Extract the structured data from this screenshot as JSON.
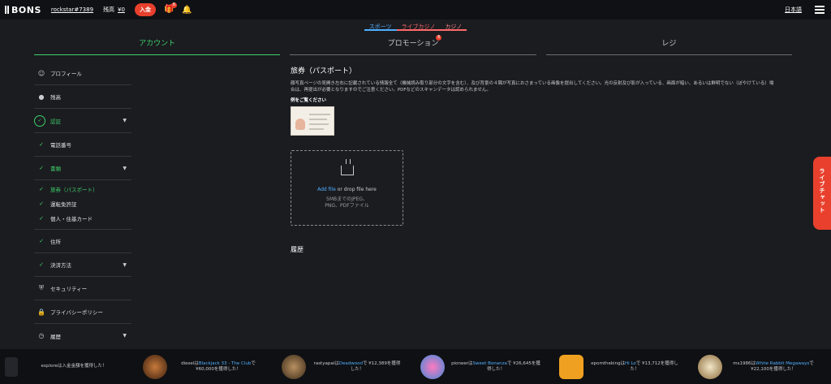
{
  "header": {
    "logo": "BONS",
    "username": "rockstar#7389",
    "balance_label": "残高",
    "balance_value": "¥0",
    "deposit_label": "入金",
    "gift_badge": "6",
    "language": "日本語"
  },
  "subnav": [
    "スポーツ",
    "ライブカジノ",
    "カジノ"
  ],
  "tabs": [
    {
      "label": "アカウント",
      "active": true
    },
    {
      "label": "プロモーション",
      "badge": "6"
    },
    {
      "label": "レジ"
    }
  ],
  "sidebar": {
    "profile": "プロフィール",
    "balance": "残高",
    "verification": "認証",
    "phone": "電話番号",
    "documents": "書類",
    "passport": "旅券（パスポート）",
    "license": "運転免許証",
    "id_card": "個人・住基カード",
    "address": "住所",
    "payment_methods": "決済方法",
    "security": "セキュリティー",
    "privacy": "プライバシーポリシー",
    "history": "履歴"
  },
  "main": {
    "title": "旅券（パスポート）",
    "description": "顔写真ページの見開き左右に記載されている情報全て（機械読み取り部分の文字を含む）、及び背景の４隅が写真におさまっている画像を提出してください。光の反射及び影が入っている、画面が暗い、あるいは鮮明でない（ぼやけている）場合は、再提出が必要となりますのでご注意ください。PDFなどのスキャンデータは認められません。",
    "example_label": "例をご覧ください",
    "upload_link": "Add file",
    "upload_text": " or drop file here",
    "upload_hint": "5MBまでのJPEG、PNG、PDFファイル",
    "history_title": "履歴"
  },
  "livechat": "ライブチャット",
  "ticker": [
    {
      "pre": "exploreは",
      "game": "",
      "post": "入金金額を獲得した！"
    },
    {
      "pre": "dieselは",
      "game": "Blackjack 33 - The Club",
      "post": "で ¥60,000を獲得した！"
    },
    {
      "pre": "rastyapalは",
      "game": "Deadwood",
      "post": "で ¥12,389を獲得した！"
    },
    {
      "pre": "pioneerは",
      "game": "Sweet Bonanza",
      "post": "で ¥26,645を獲得した！"
    },
    {
      "pre": "epomthekingは",
      "game": "Hi Lo",
      "post": "で ¥13,712を獲得した！"
    },
    {
      "pre": "ms1986は",
      "game": "White Rabbit Megaways",
      "post": "で ¥22,100を獲得した！"
    }
  ],
  "colors": {
    "accent_green": "#3ecf6a",
    "accent_red": "#e8402d",
    "link_blue": "#4fb0ff"
  }
}
